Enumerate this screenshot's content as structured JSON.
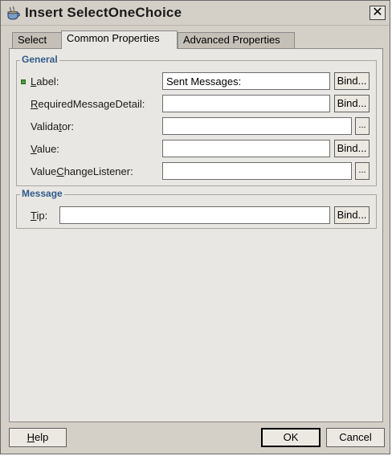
{
  "window": {
    "title": "Insert SelectOneChoice",
    "close_glyph": "✕",
    "icon": "java-coffee-cup-icon"
  },
  "tabs": [
    {
      "label": "Select",
      "active": false
    },
    {
      "label": "Common Properties",
      "active": true
    },
    {
      "label": "Advanced Properties",
      "active": false
    }
  ],
  "general": {
    "title": "General",
    "rows": [
      {
        "label": "Label:",
        "mnemonic": "L",
        "rest": "abel:",
        "value": "Sent Messages:",
        "button": "Bind...",
        "required": true
      },
      {
        "label": "RequiredMessageDetail:",
        "mnemonic": "R",
        "rest": "equiredMessageDetail:",
        "value": "",
        "button": "Bind..."
      },
      {
        "label": "Validator:",
        "pre": "Valida",
        "mnemonic": "t",
        "rest": "or:",
        "value": "",
        "button": "..."
      },
      {
        "label": "Value:",
        "mnemonic": "V",
        "rest": "alue:",
        "value": "",
        "button": "Bind..."
      },
      {
        "label": "ValueChangeListener:",
        "pre": "Value",
        "mnemonic": "C",
        "rest": "hangeListener:",
        "value": "",
        "button": "..."
      }
    ]
  },
  "message": {
    "title": "Message",
    "tip": {
      "label": "Tip:",
      "mnemonic": "T",
      "rest": "ip:",
      "value": "",
      "button": "Bind..."
    }
  },
  "footer": {
    "help": "Help",
    "help_mnemonic": "H",
    "help_rest": "elp",
    "ok": "OK",
    "cancel": "Cancel"
  },
  "colors": {
    "dialog_bg": "#d4d0c8",
    "panel_bg": "#e9e7e3",
    "group_title": "#2f5b8a",
    "required_bullet": "#4f9b3a"
  }
}
